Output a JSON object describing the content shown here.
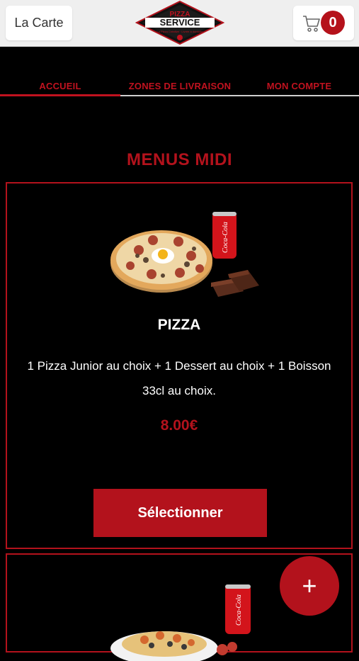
{
  "header": {
    "menu_label": "La Carte",
    "logo_top": "PIZZA",
    "logo_main": "SERVICE",
    "logo_tagline": "La Pizza Créative · Livrée à domicile",
    "cart_count": "0",
    "cart_icon": "cart-icon"
  },
  "tabs": [
    {
      "label": "ACCUEIL",
      "active": true
    },
    {
      "label": "ZONES DE LIVRAISON",
      "active": false
    },
    {
      "label": "MON COMPTE",
      "active": false
    }
  ],
  "section": {
    "title": "MENUS MIDI"
  },
  "products": [
    {
      "name": "PIZZA",
      "description": "1 Pizza Junior au choix  + 1 Dessert au choix  + 1 Boisson 33cl au choix.",
      "price": "8.00€",
      "button_label": "Sélectionner"
    }
  ],
  "fab": {
    "label": "+"
  },
  "colors": {
    "accent": "#b3121c",
    "background": "#000000",
    "topbar": "#efefef"
  }
}
